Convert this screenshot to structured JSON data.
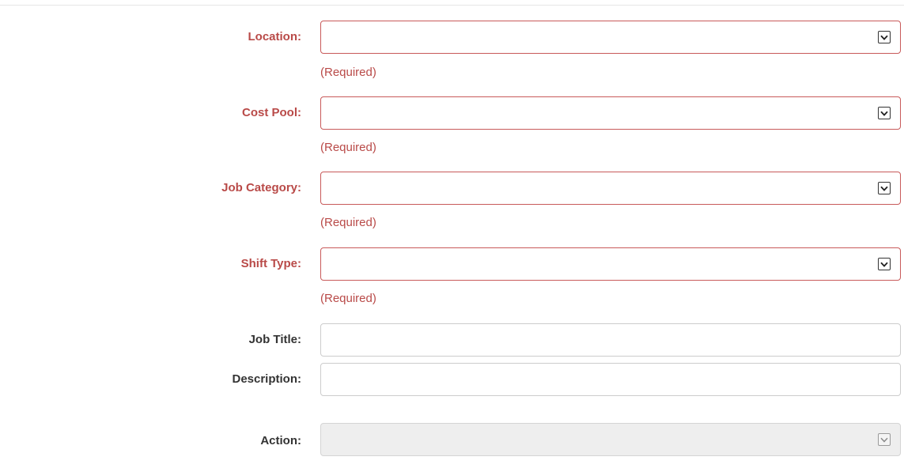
{
  "form": {
    "required_note": "(Required)",
    "fields": [
      {
        "key": "location",
        "label": "Location:",
        "type": "select",
        "required": true,
        "value": ""
      },
      {
        "key": "cost_pool",
        "label": "Cost Pool:",
        "type": "select",
        "required": true,
        "value": ""
      },
      {
        "key": "job_category",
        "label": "Job Category:",
        "type": "select",
        "required": true,
        "value": ""
      },
      {
        "key": "shift_type",
        "label": "Shift Type:",
        "type": "select",
        "required": true,
        "value": ""
      },
      {
        "key": "job_title",
        "label": "Job Title:",
        "type": "text",
        "required": false,
        "value": ""
      },
      {
        "key": "description",
        "label": "Description:",
        "type": "text",
        "required": false,
        "value": ""
      },
      {
        "key": "action",
        "label": "Action:",
        "type": "select",
        "required": false,
        "disabled": true,
        "value": ""
      }
    ]
  },
  "colors": {
    "error": "#b94a48",
    "error_border": "#c85a5a",
    "label": "#333333",
    "disabled_bg": "#eeeeee"
  },
  "icons": {
    "dropdown": "chevron-down-icon"
  }
}
